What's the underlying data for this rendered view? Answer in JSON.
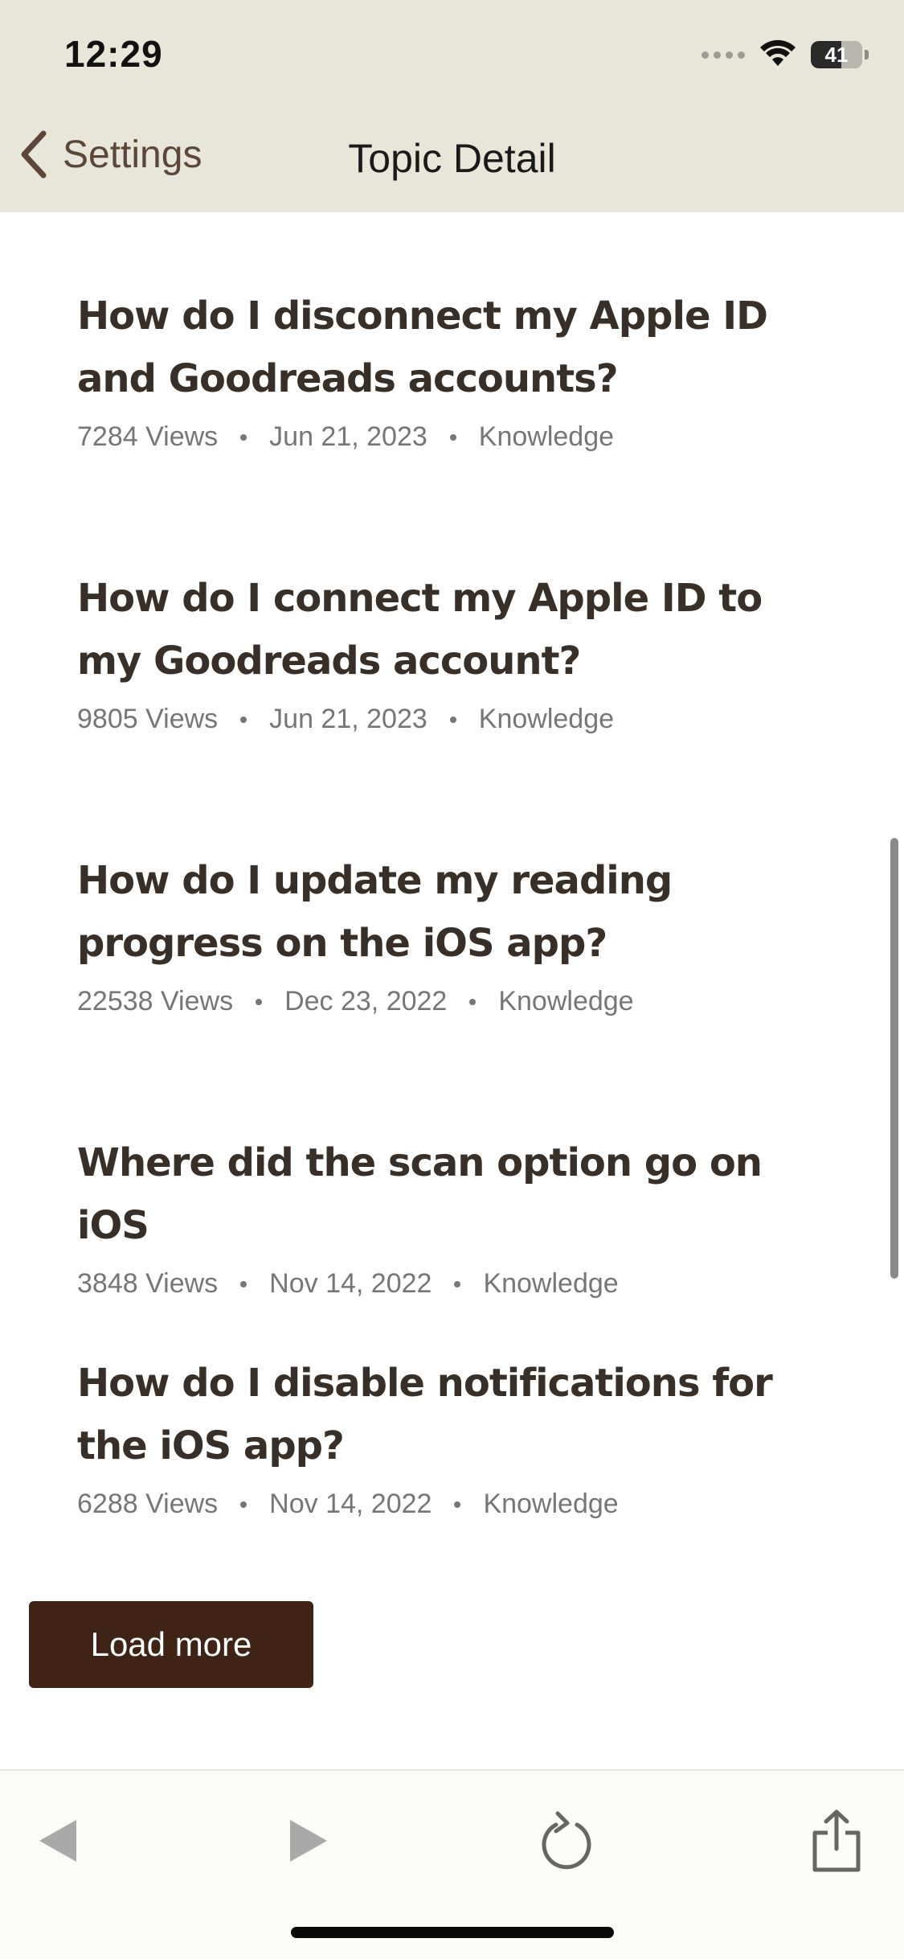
{
  "status_bar": {
    "time": "12:29",
    "battery_level": "41"
  },
  "nav": {
    "back_label": "Settings",
    "title": "Topic Detail"
  },
  "articles": [
    {
      "title": "How do I disconnect my Apple ID and Goodreads accounts?",
      "views": "7284 Views",
      "date": "Jun 21, 2023",
      "category": "Knowledge"
    },
    {
      "title": "How do I connect my Apple ID to my Goodreads account?",
      "views": "9805 Views",
      "date": "Jun 21, 2023",
      "category": "Knowledge"
    },
    {
      "title": "How do I update my reading progress on the iOS app?",
      "views": "22538 Views",
      "date": "Dec 23, 2022",
      "category": "Knowledge"
    },
    {
      "title": "Where did the scan option go on iOS",
      "views": "3848 Views",
      "date": "Nov 14, 2022",
      "category": "Knowledge"
    },
    {
      "title": "How do I disable notifications for the iOS app?",
      "views": "6288 Views",
      "date": "Nov 14, 2022",
      "category": "Knowledge"
    }
  ],
  "load_more_label": "Load more",
  "toolbar": {
    "icons": [
      "back-arrow-icon",
      "forward-arrow-icon",
      "reload-icon",
      "share-icon"
    ]
  },
  "colors": {
    "header_bg": "#e8e5d9",
    "accent_brown": "#3f2416",
    "title_text": "#382f28",
    "meta_text": "#767676"
  }
}
